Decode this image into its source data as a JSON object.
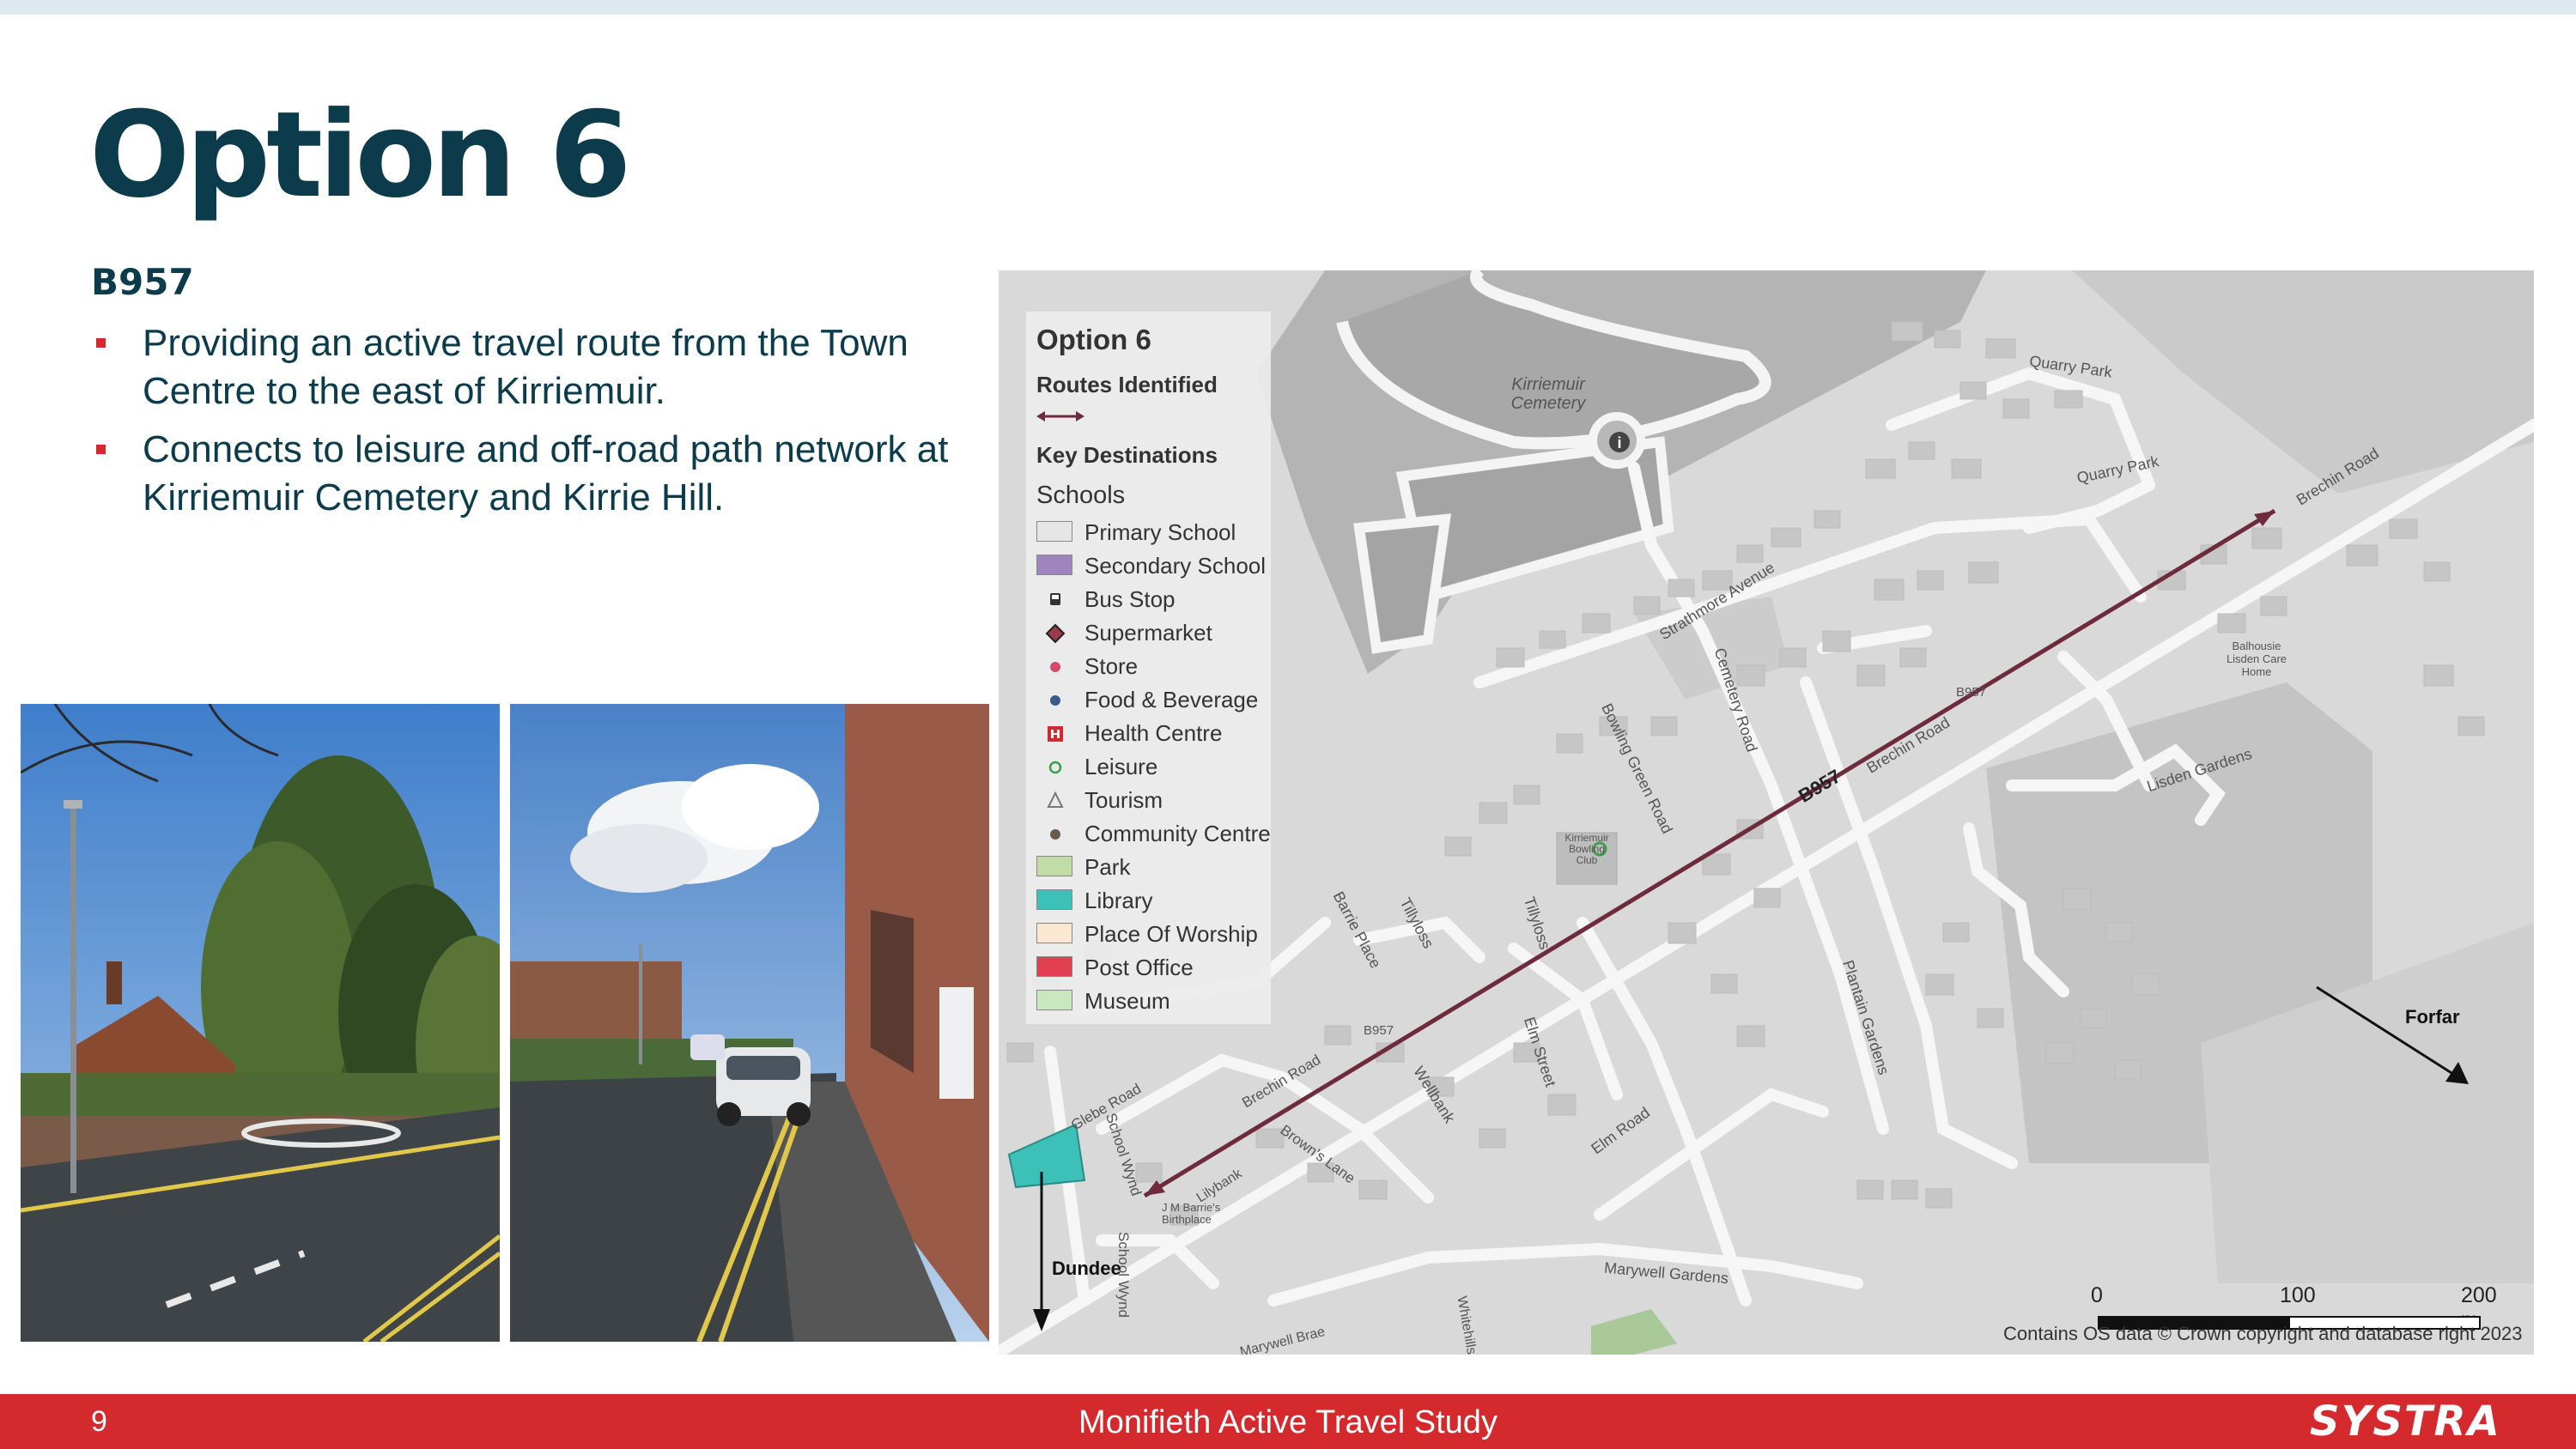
{
  "slide": {
    "title": "Option 6",
    "subtitle": "B957",
    "bullets": [
      "Providing an active travel route from the Town Centre to the east of Kirriemuir.",
      "Connects to leisure and off-road path network at Kirriemuir Cemetery and Kirrie Hill."
    ]
  },
  "map": {
    "legend": {
      "title": "Option 6",
      "routes_heading": "Routes Identified",
      "key_destinations_heading": "Key Destinations",
      "schools_heading": "Schools",
      "items": [
        {
          "label": "Primary School",
          "symbol": "swatch",
          "color": "#e6e6e6"
        },
        {
          "label": "Secondary School",
          "symbol": "swatch",
          "color": "#a084c0"
        },
        {
          "label": "Bus Stop",
          "symbol": "bus-stop-icon",
          "color": "#333333"
        },
        {
          "label": "Supermarket",
          "symbol": "diamond",
          "color": "#9b3a4a"
        },
        {
          "label": "Store",
          "symbol": "dot",
          "color": "#d24a6a"
        },
        {
          "label": "Food & Beverage",
          "symbol": "dot",
          "color": "#3a5a8a"
        },
        {
          "label": "Health Centre",
          "symbol": "health-icon",
          "color": "#d42a2e"
        },
        {
          "label": "Leisure",
          "symbol": "ring",
          "color": "#3aa04a"
        },
        {
          "label": "Tourism",
          "symbol": "triangle",
          "color": "#777777"
        },
        {
          "label": "Community Centre",
          "symbol": "dot",
          "color": "#6a5a4a"
        },
        {
          "label": "Park",
          "symbol": "swatch",
          "color": "#c2dca6"
        },
        {
          "label": "Library",
          "symbol": "swatch",
          "color": "#3cc0b8"
        },
        {
          "label": "Place Of Worship",
          "symbol": "swatch",
          "color": "#fbe8d2"
        },
        {
          "label": "Post Office",
          "symbol": "swatch",
          "color": "#e04050"
        },
        {
          "label": "Museum",
          "symbol": "swatch",
          "color": "#c8e8c0"
        }
      ]
    },
    "labels": {
      "cemetery": "Kirriemuir Cemetery",
      "quarry_park_1": "Quarry Park",
      "quarry_park_2": "Quarry Park",
      "brechin_road_1": "Brechin Road",
      "brechin_road_2": "Brechin Road",
      "brechin_road_3": "Brechin Road",
      "b957_main": "B957",
      "b957_small_1": "B957",
      "b957_small_2": "B957",
      "strathmore_avenue": "Strathmore Avenue",
      "cemetery_road": "Cemetery Road",
      "bowling_green_road": "Bowling Green Road",
      "bowling_club": "Kirriemuir Bowling Club",
      "lisden_gardens": "Lisden Gardens",
      "balhousie": "Balhousie Lisden Care Home",
      "barrie_place": "Barrie Place",
      "tillyloss_1": "Tillyloss",
      "tillyloss_2": "Tillyloss",
      "elm_street": "Elm Street",
      "wellbank": "Wellbank",
      "elm_road": "Elm Road",
      "glebe_road": "Glebe Road",
      "school_wynd_1": "School Wynd",
      "school_wynd_2": "School Wynd",
      "browns_lane": "Brown's Lane",
      "lilybank": "Lilybank",
      "jm_barries": "J M Barrie's Birthplace",
      "maryswell_gardens": "Marywell Gardens",
      "maryswell_brae": "Marywell Brae",
      "whitehills": "Whitehills",
      "plantain_gardens": "Plantain Gardens",
      "dundee": "Dundee",
      "forfar": "Forfar"
    },
    "scale": {
      "zero": "0",
      "mid": "100",
      "end": "200 m"
    },
    "copyright": "Contains OS data © Crown copyright and database right 2023"
  },
  "footer": {
    "page_number": "9",
    "study_title": "Monifieth Active Travel Study",
    "brand": "SYSTRA"
  },
  "colors": {
    "title": "#0c3c4c",
    "accent_red": "#d42a2e",
    "route": "#6e2a3e"
  }
}
